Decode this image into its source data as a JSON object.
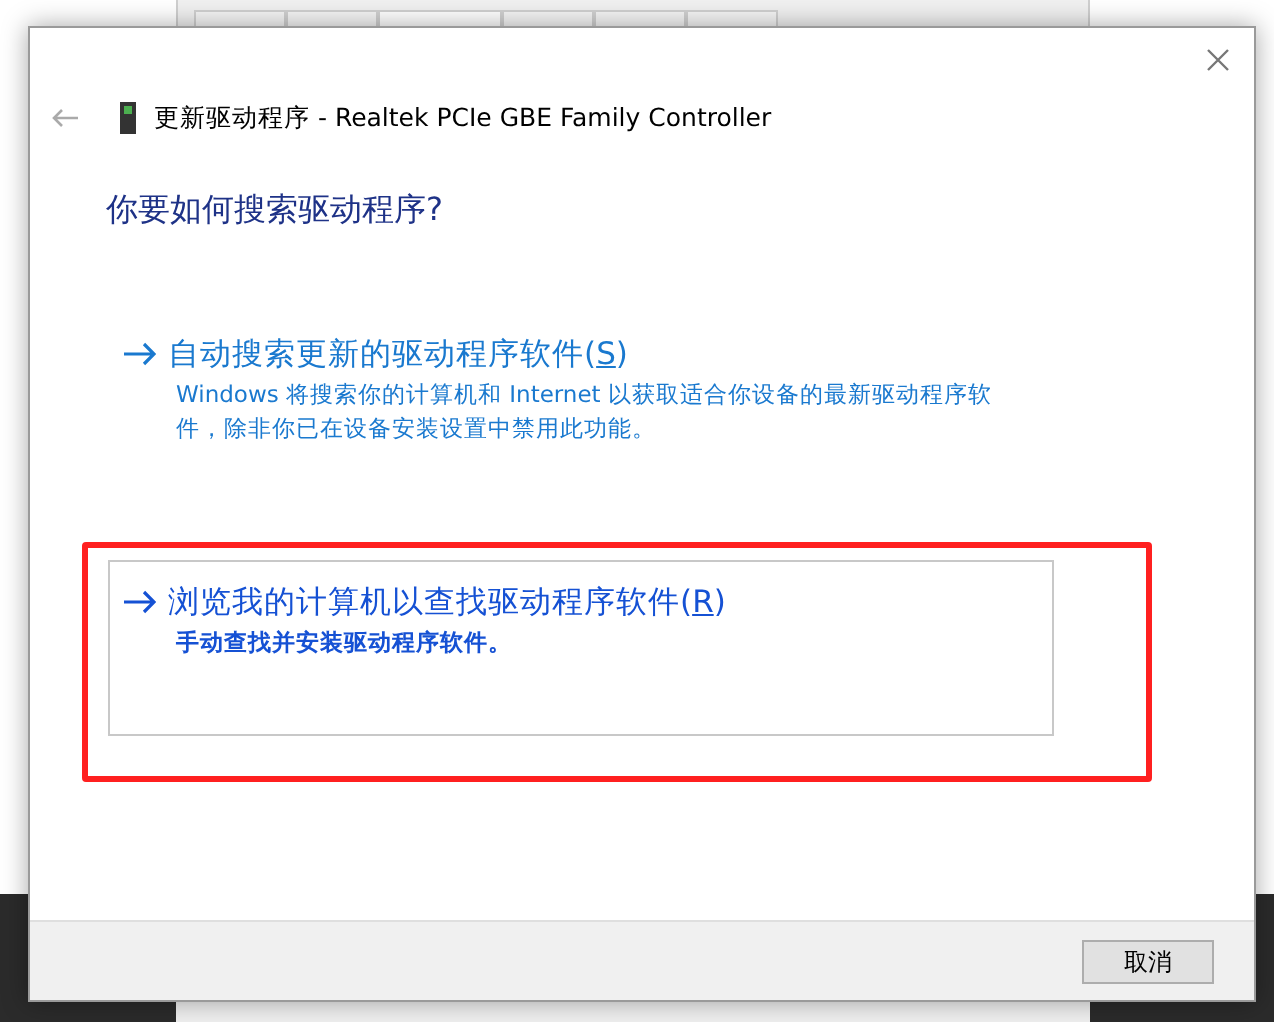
{
  "dialog": {
    "title": "更新驱动程序 - Realtek PCIe GBE Family Controller",
    "heading": "你要如何搜索驱动程序?",
    "options": [
      {
        "label_before": "自动搜索更新的驱动程序软件(",
        "access_key": "S",
        "label_after": ")",
        "description": "Windows 将搜索你的计算机和 Internet 以获取适合你设备的最新驱动程序软件，除非你已在设备安装设置中禁用此功能。",
        "selected": false,
        "annotated": false
      },
      {
        "label_before": "浏览我的计算机以查找驱动程序软件(",
        "access_key": "R",
        "label_after": ")",
        "description": "手动查找并安装驱动程序软件。",
        "selected": true,
        "annotated": true
      }
    ],
    "buttons": [
      "取消"
    ]
  }
}
